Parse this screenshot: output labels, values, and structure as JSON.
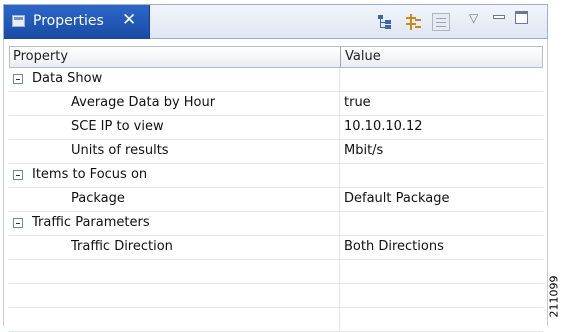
{
  "view": {
    "title": "Properties",
    "close_glyph": "✕",
    "icons": [
      "properties-view-icon",
      "show-categories-icon",
      "filter-icon",
      "advanced-properties-icon",
      "view-menu-icon",
      "minimize-icon",
      "maximize-icon"
    ]
  },
  "table": {
    "columns": [
      "Property",
      "Value"
    ],
    "rows": [
      {
        "type": "category",
        "label": "Data Show",
        "value": ""
      },
      {
        "type": "property",
        "label": "Average Data by Hour",
        "value": "true"
      },
      {
        "type": "property",
        "label": "SCE IP to view",
        "value": "10.10.10.12"
      },
      {
        "type": "property",
        "label": "Units of results",
        "value": "Mbit/s"
      },
      {
        "type": "category",
        "label": "Items to Focus on",
        "value": ""
      },
      {
        "type": "property",
        "label": "Package",
        "value": "Default Package"
      },
      {
        "type": "category",
        "label": "Traffic Parameters",
        "value": ""
      },
      {
        "type": "property",
        "label": "Traffic Direction",
        "value": "Both Directions"
      }
    ]
  },
  "figure_id": "211099"
}
